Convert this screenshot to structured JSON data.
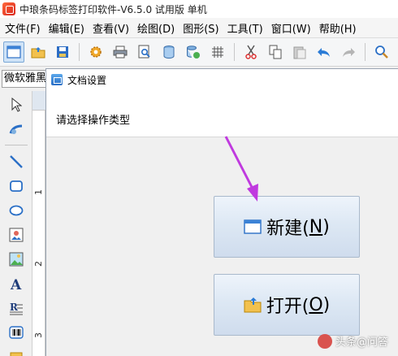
{
  "window": {
    "title": "中琅条码标签打印软件-V6.5.0 试用版 单机"
  },
  "menu": [
    {
      "label": "文件(F)"
    },
    {
      "label": "编辑(E)"
    },
    {
      "label": "查看(V)"
    },
    {
      "label": "绘图(D)"
    },
    {
      "label": "图形(S)"
    },
    {
      "label": "工具(T)"
    },
    {
      "label": "窗口(W)"
    },
    {
      "label": "帮助(H)"
    }
  ],
  "toolbar": {
    "icons": [
      "new-document-icon",
      "open-folder-icon",
      "save-icon",
      "settings-gear-icon",
      "print-icon",
      "print-preview-icon",
      "database-icon",
      "database-settings-icon",
      "grid-icon",
      "cut-icon",
      "copy-icon",
      "paste-icon",
      "undo-icon",
      "redo-icon",
      "zoom-icon"
    ]
  },
  "font": {
    "value": "微软雅黑"
  },
  "palette": {
    "icons": [
      "select-arrow-icon",
      "pan-tool-icon",
      "line-tool-icon",
      "rectangle-tool-icon",
      "ellipse-tool-icon",
      "image-tool-icon",
      "picture-tool-icon",
      "text-tool-icon",
      "rich-text-tool-icon",
      "barcode-tool-icon",
      "more-tool-icon"
    ]
  },
  "ruler": {
    "marks": [
      "1",
      "2",
      "3"
    ]
  },
  "dialog": {
    "title": "文档设置",
    "prompt": "请选择操作类型",
    "new_button": {
      "text": "新建(",
      "mnemonic": "N",
      "suffix": ")"
    },
    "open_button": {
      "text": "打开(",
      "mnemonic": "O",
      "suffix": ")"
    }
  },
  "watermark": {
    "text": "头条@问答"
  },
  "colors": {
    "accent": "#c03adf",
    "button_border": "#a9b9cc"
  }
}
